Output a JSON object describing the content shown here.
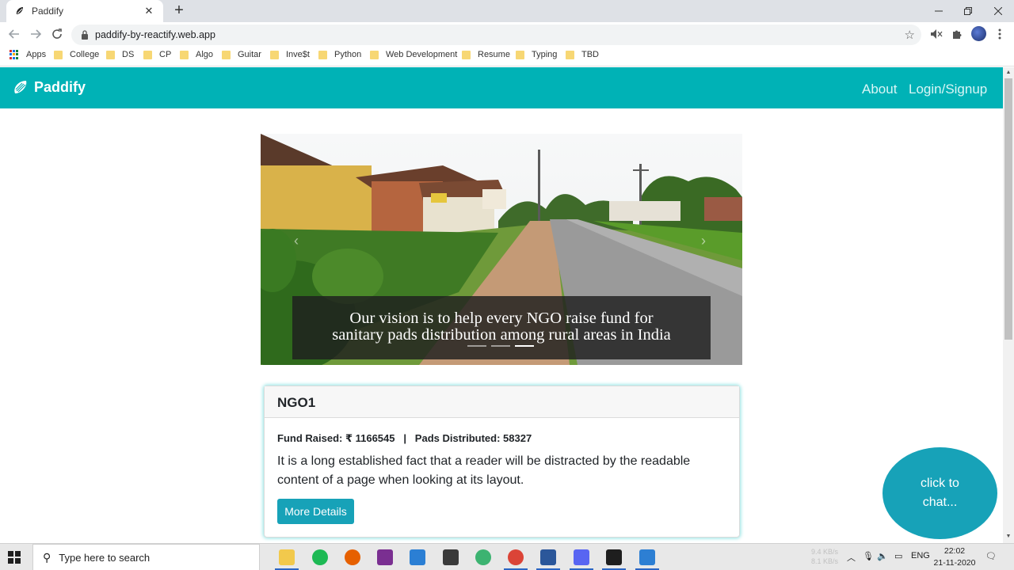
{
  "browser": {
    "tab_title": "Paddify",
    "tab_close": "✕",
    "new_tab": "+",
    "url": "paddify-by-reactify.web.app",
    "bookmarks": [
      "Apps",
      "College",
      "DS",
      "CP",
      "Algo",
      "Guitar",
      "Inve$t",
      "Python",
      "Web Development",
      "Resume",
      "Typing",
      "TBD"
    ]
  },
  "site": {
    "brand": "Paddify",
    "nav": {
      "about": "About",
      "login": "Login/Signup"
    },
    "carousel": {
      "caption_line1": "Our vision is to help every NGO raise fund for",
      "caption_line2": "sanitary pads distribution among rural areas in India",
      "slide_count": 3,
      "active_slide": 3
    },
    "card": {
      "title": "NGO1",
      "stats": "Fund Raised: ₹ 1166545   |   Pads Distributed: 58327",
      "text": "It is a long established fact that a reader will be distracted by the readable content of a page when looking at its layout.",
      "button": "More Details"
    },
    "chat": {
      "line1": "click to",
      "line2": "chat..."
    }
  },
  "taskbar": {
    "search_placeholder": "Type here to search",
    "net_up": "9.4 KB/s",
    "net_down": "8.1 KB/s",
    "language": "ENG",
    "time": "22:02",
    "date": "21-11-2020"
  },
  "colors": {
    "navbar": "#00b2b6",
    "button": "#17a2b8"
  }
}
